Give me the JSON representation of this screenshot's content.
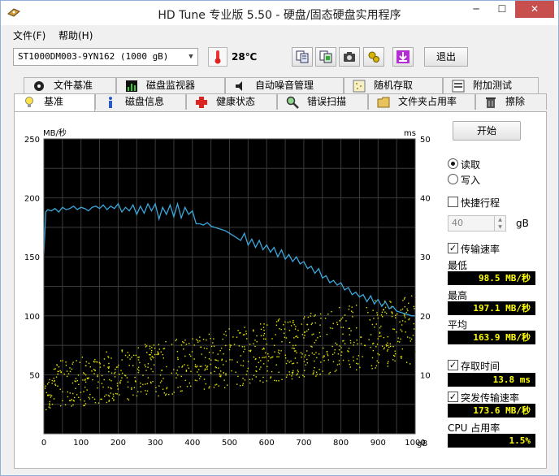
{
  "window": {
    "title": "HD Tune 专业版 5.50 - 硬盘/固态硬盘实用程序",
    "minimize": "─",
    "maximize": "☐",
    "close": "✕"
  },
  "menu": [
    {
      "label": "文件(F)"
    },
    {
      "label": "帮助(H)"
    }
  ],
  "toolbar": {
    "drive": "ST1000DM003-9YN162 (1000 gB)",
    "temperature": "28℃",
    "exit_label": "退出"
  },
  "tabs_row1": [
    {
      "label": "文件基准",
      "icon": "file-benchmark-icon"
    },
    {
      "label": "磁盘监视器",
      "icon": "disk-monitor-icon"
    },
    {
      "label": "自动噪音管理",
      "icon": "speaker-icon"
    },
    {
      "label": "随机存取",
      "icon": "random-access-icon"
    },
    {
      "label": "附加测试",
      "icon": "extra-tests-icon"
    }
  ],
  "tabs_row2": [
    {
      "label": "基准",
      "icon": "lightbulb-icon",
      "active": true
    },
    {
      "label": "磁盘信息",
      "icon": "info-icon"
    },
    {
      "label": "健康状态",
      "icon": "health-cross-icon"
    },
    {
      "label": "错误扫描",
      "icon": "magnifier-icon"
    },
    {
      "label": "文件夹占用率",
      "icon": "folder-icon"
    },
    {
      "label": "擦除",
      "icon": "trash-icon"
    }
  ],
  "controls": {
    "start_label": "开始",
    "read_label": "读取",
    "write_label": "写入",
    "mode_selected": "read",
    "short_stroke_label": "快捷行程",
    "short_stroke_checked": false,
    "short_stroke_value": "40",
    "short_stroke_unit": "gB",
    "transfer_rate_label": "传输速率",
    "transfer_rate_checked": true,
    "min_label": "最低",
    "min_value": "98.5 MB/秒",
    "max_label": "最高",
    "max_value": "197.1 MB/秒",
    "avg_label": "平均",
    "avg_value": "163.9 MB/秒",
    "access_time_label": "存取时间",
    "access_time_checked": true,
    "access_time_value": "13.8 ms",
    "burst_label": "突发传输速率",
    "burst_checked": true,
    "burst_value": "173.6 MB/秒",
    "cpu_label": "CPU 占用率",
    "cpu_value": "1.5%"
  },
  "chart_data": {
    "type": "line",
    "ylabel_left": "MB/秒",
    "ylabel_right": "ms",
    "x_unit": "gB",
    "xlim": [
      0,
      1000
    ],
    "ylim_left": [
      0,
      250
    ],
    "ylim_right": [
      0,
      50
    ],
    "x_ticks": [
      0,
      100,
      200,
      300,
      400,
      500,
      600,
      700,
      800,
      900,
      1000
    ],
    "y_ticks_left": [
      50,
      100,
      150,
      200,
      250
    ],
    "y_ticks_right": [
      10,
      20,
      30,
      40,
      50
    ],
    "grid": true,
    "colors": {
      "background": "#000000",
      "grid": "#3c3c3c",
      "transfer": "#3ba8dc",
      "access": "#e6e600"
    },
    "series": [
      {
        "kind": "transfer_rate",
        "axis": "left",
        "x": [
          0,
          5,
          10,
          20,
          30,
          40,
          50,
          60,
          70,
          80,
          90,
          100,
          110,
          120,
          130,
          140,
          150,
          160,
          170,
          180,
          190,
          200,
          210,
          220,
          230,
          240,
          250,
          260,
          270,
          280,
          290,
          300,
          310,
          320,
          330,
          340,
          350,
          360,
          370,
          380,
          390,
          400,
          410,
          420,
          430,
          440,
          450,
          460,
          470,
          480,
          490,
          500,
          510,
          520,
          530,
          540,
          550,
          560,
          570,
          580,
          590,
          600,
          610,
          620,
          630,
          640,
          650,
          660,
          670,
          680,
          690,
          700,
          710,
          720,
          730,
          740,
          750,
          760,
          770,
          780,
          790,
          800,
          810,
          820,
          830,
          840,
          850,
          860,
          870,
          880,
          890,
          900,
          910,
          920,
          930,
          940,
          950,
          960,
          970,
          980,
          990,
          1000
        ],
        "y": [
          152,
          188,
          190,
          189,
          191,
          188,
          192,
          190,
          191,
          193,
          190,
          192,
          191,
          189,
          192,
          193,
          191,
          194,
          190,
          193,
          191,
          195,
          188,
          192,
          189,
          194,
          186,
          193,
          187,
          195,
          189,
          195,
          182,
          192,
          186,
          194,
          184,
          195,
          183,
          192,
          186,
          189,
          178,
          178,
          177,
          179,
          176,
          175,
          174,
          173,
          172,
          170,
          168,
          166,
          164,
          170,
          160,
          165,
          158,
          164,
          156,
          160,
          154,
          158,
          150,
          156,
          148,
          152,
          146,
          150,
          144,
          146,
          140,
          142,
          136,
          140,
          132,
          134,
          128,
          130,
          126,
          128,
          122,
          124,
          118,
          120,
          116,
          118,
          112,
          117,
          110,
          114,
          108,
          112,
          106,
          108,
          104,
          103,
          102,
          101,
          100,
          100
        ]
      },
      {
        "kind": "access_time",
        "axis": "right",
        "style": "scatter",
        "x_range": [
          0,
          1000
        ],
        "y_range_min_at_start": [
          4,
          12
        ],
        "y_range_min_at_end": [
          12,
          24
        ],
        "count": 900
      }
    ]
  }
}
